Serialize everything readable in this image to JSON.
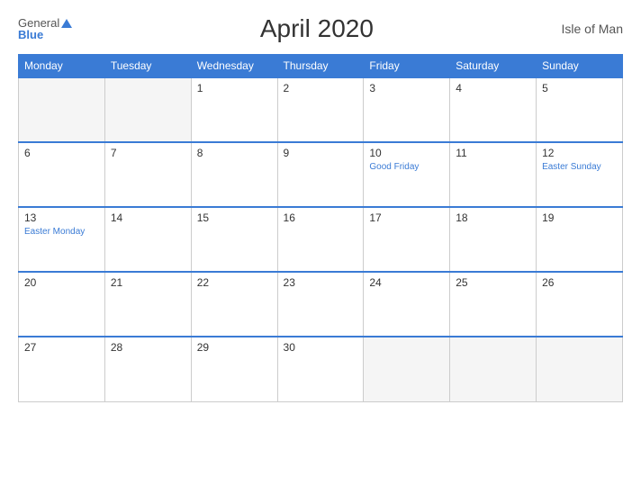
{
  "header": {
    "logo_general": "General",
    "logo_blue": "Blue",
    "title": "April 2020",
    "region": "Isle of Man"
  },
  "weekdays": [
    "Monday",
    "Tuesday",
    "Wednesday",
    "Thursday",
    "Friday",
    "Saturday",
    "Sunday"
  ],
  "weeks": [
    [
      {
        "day": "",
        "holiday": "",
        "empty": true
      },
      {
        "day": "",
        "holiday": "",
        "empty": true
      },
      {
        "day": "1",
        "holiday": ""
      },
      {
        "day": "2",
        "holiday": ""
      },
      {
        "day": "3",
        "holiday": ""
      },
      {
        "day": "4",
        "holiday": ""
      },
      {
        "day": "5",
        "holiday": ""
      }
    ],
    [
      {
        "day": "6",
        "holiday": ""
      },
      {
        "day": "7",
        "holiday": ""
      },
      {
        "day": "8",
        "holiday": ""
      },
      {
        "day": "9",
        "holiday": ""
      },
      {
        "day": "10",
        "holiday": "Good Friday"
      },
      {
        "day": "11",
        "holiday": ""
      },
      {
        "day": "12",
        "holiday": "Easter Sunday"
      }
    ],
    [
      {
        "day": "13",
        "holiday": "Easter Monday"
      },
      {
        "day": "14",
        "holiday": ""
      },
      {
        "day": "15",
        "holiday": ""
      },
      {
        "day": "16",
        "holiday": ""
      },
      {
        "day": "17",
        "holiday": ""
      },
      {
        "day": "18",
        "holiday": ""
      },
      {
        "day": "19",
        "holiday": ""
      }
    ],
    [
      {
        "day": "20",
        "holiday": ""
      },
      {
        "day": "21",
        "holiday": ""
      },
      {
        "day": "22",
        "holiday": ""
      },
      {
        "day": "23",
        "holiday": ""
      },
      {
        "day": "24",
        "holiday": ""
      },
      {
        "day": "25",
        "holiday": ""
      },
      {
        "day": "26",
        "holiday": ""
      }
    ],
    [
      {
        "day": "27",
        "holiday": ""
      },
      {
        "day": "28",
        "holiday": ""
      },
      {
        "day": "29",
        "holiday": ""
      },
      {
        "day": "30",
        "holiday": ""
      },
      {
        "day": "",
        "holiday": "",
        "empty": true
      },
      {
        "day": "",
        "holiday": "",
        "empty": true
      },
      {
        "day": "",
        "holiday": "",
        "empty": true
      }
    ]
  ]
}
